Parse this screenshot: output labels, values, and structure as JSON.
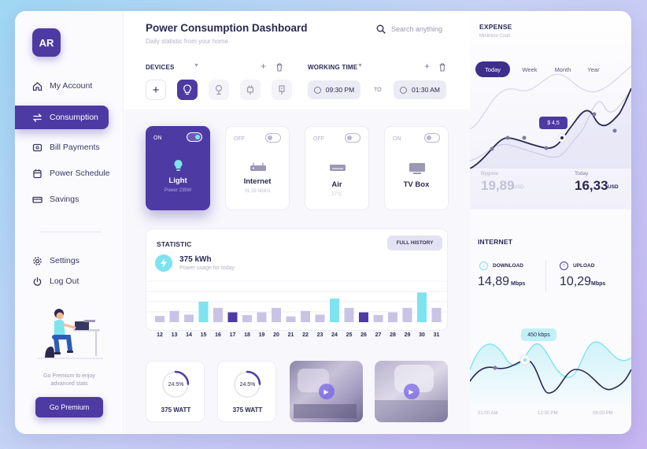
{
  "colors": {
    "accent": "#4e3aa3",
    "cyan": "#7de3ef",
    "lavender": "#c9c3e6"
  },
  "sidebar": {
    "avatar": "AR",
    "items": [
      {
        "label": "My Account",
        "icon": "home-icon"
      },
      {
        "label": "Consumption",
        "icon": "transfer-icon"
      },
      {
        "label": "Bill Payments",
        "icon": "wallet-icon"
      },
      {
        "label": "Power Schedule",
        "icon": "calendar-icon"
      },
      {
        "label": "Savings",
        "icon": "money-icon"
      }
    ],
    "settings": "Settings",
    "logout": "Log Out",
    "premium_text": "Go Premium to enjoy advanced stats",
    "premium_button": "Go Premium"
  },
  "header": {
    "title": "Power Consumption Dashboard",
    "subtitle": "Daily statistic from your home",
    "search_placeholder": "Search anything"
  },
  "devices_label": "DEVICES",
  "working_time": {
    "label": "WORKING TIME",
    "from": "09:30 PM",
    "to_label": "TO",
    "to": "01:30 AM"
  },
  "devices": [
    {
      "status": "ON",
      "name": "Light",
      "sub": "Power 235W",
      "icon": "bulb-icon"
    },
    {
      "status": "OFF",
      "name": "Internet",
      "sub": "91.59 Mbit/s",
      "icon": "router-icon"
    },
    {
      "status": "OFF",
      "name": "Air",
      "sub": "27°C",
      "icon": "air-conditioner-icon"
    },
    {
      "status": "ON",
      "name": "TV Box",
      "sub": "",
      "icon": "tv-icon"
    }
  ],
  "statistic": {
    "title": "STATISTIC",
    "button": "FULL HISTORY",
    "value": "375 kWh",
    "caption": "Power usage for today"
  },
  "chart_data": {
    "type": "bar",
    "categories": [
      "12",
      "13",
      "14",
      "15",
      "16",
      "17",
      "18",
      "19",
      "20",
      "21",
      "22",
      "23",
      "24",
      "25",
      "26",
      "27",
      "28",
      "29",
      "30",
      "31"
    ],
    "values": [
      0.3,
      0.55,
      0.37,
      1.0,
      0.7,
      0.48,
      0.35,
      0.48,
      0.7,
      0.28,
      0.55,
      0.37,
      1.15,
      0.7,
      0.48,
      0.35,
      0.48,
      0.7,
      1.45,
      0.7
    ],
    "bar_colors": [
      "lav",
      "lav",
      "lav",
      "cyan",
      "lav",
      "dark",
      "lav",
      "lav",
      "lav",
      "lav",
      "lav",
      "lav",
      "cyan",
      "lav",
      "dark",
      "lav",
      "lav",
      "lav",
      "cyan",
      "lav"
    ]
  },
  "gauges": [
    {
      "percent": "24.5%",
      "label": "375 WATT",
      "fraction": 0.245
    },
    {
      "percent": "24.5%",
      "label": "375 WATT",
      "fraction": 0.245
    }
  ],
  "expense": {
    "title": "EXPENSE",
    "subtitle": "Minimize Cost!",
    "tabs": [
      "Today",
      "Week",
      "Month",
      "Year"
    ],
    "tooltip": "$ 4,5",
    "bygone_label": "Bygone",
    "bygone_value": "19,89",
    "bygone_unit": "USD",
    "today_label": "Today",
    "today_value": "16,33",
    "today_unit": "USD"
  },
  "internet": {
    "title": "INTERNET",
    "download_label": "DOWNLOAD",
    "download_value": "14,89",
    "download_unit": "Mbps",
    "upload_label": "UPLOAD",
    "upload_value": "10,29",
    "upload_unit": "Mbps",
    "tooltip": "450 kbps",
    "times": [
      "01:00 AM",
      "12:00 PM",
      "09:00 PM"
    ]
  }
}
